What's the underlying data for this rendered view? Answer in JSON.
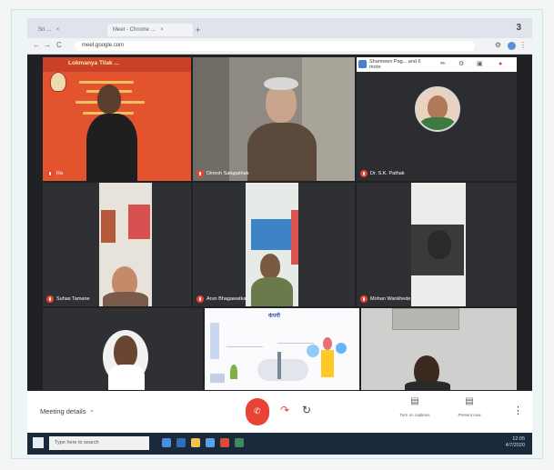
{
  "browser": {
    "tabs": [
      {
        "label": "Sri ...",
        "close": "×"
      },
      {
        "label": "Meet - Chrome ...",
        "close": "×"
      }
    ],
    "new_tab": "+",
    "tab_count": "3",
    "url": "meet.google.com",
    "nav": {
      "back": "←",
      "forward": "→",
      "reload": "C"
    }
  },
  "participants": [
    {
      "name": "Ra",
      "banner": "Lokmanya Tilak ..."
    },
    {
      "name": "Dinesh Satapathak"
    },
    {
      "name": "Dr. S.K. Pathak"
    },
    {
      "name": "Suhas Tamane"
    },
    {
      "name": "Arun Bhagawatkar"
    },
    {
      "name": "Mohan Wankhede"
    },
    {
      "name": ""
    },
    {
      "name": ""
    },
    {
      "name": ""
    }
  ],
  "presenting": {
    "label": "Sharmeen Pag... and 6 more"
  },
  "slide": {
    "title": "कंपनी"
  },
  "bottom": {
    "meeting_details": "Meeting details",
    "chevron": "^",
    "present_now": "Present now",
    "captions": "Turn on captions",
    "more": "⋮"
  },
  "taskbar": {
    "search_placeholder": "Type here to search",
    "time": "12:05",
    "date": "4/7/2020"
  },
  "colors": {
    "end_call": "#ea4335",
    "meet_background": "#202124",
    "banner": "#e3542e",
    "taskbar": "#1b2a3a"
  },
  "icons": [
    "mic-off-icon",
    "end-call-icon",
    "present-icon",
    "captions-icon",
    "kebab-menu-icon"
  ]
}
